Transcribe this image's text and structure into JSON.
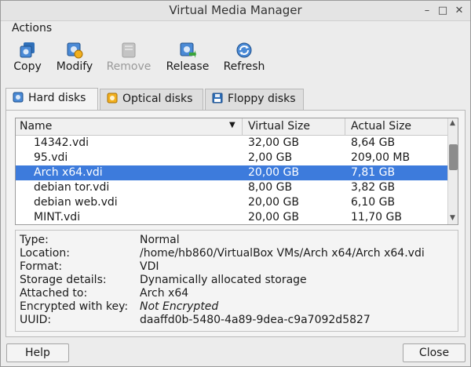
{
  "window": {
    "title": "Virtual Media Manager"
  },
  "menubar": {
    "actions_label": "Actions"
  },
  "toolbar": {
    "copy": {
      "label": "Copy",
      "icon": "copy-disk-icon"
    },
    "modify": {
      "label": "Modify",
      "icon": "modify-disk-icon"
    },
    "remove": {
      "label": "Remove",
      "icon": "remove-disk-icon",
      "enabled": false
    },
    "release": {
      "label": "Release",
      "icon": "release-disk-icon"
    },
    "refresh": {
      "label": "Refresh",
      "icon": "refresh-icon"
    }
  },
  "tabs": [
    {
      "label": "Hard disks",
      "active": true
    },
    {
      "label": "Optical disks",
      "active": false
    },
    {
      "label": "Floppy disks",
      "active": false
    }
  ],
  "list": {
    "columns": [
      "Name",
      "Virtual Size",
      "Actual Size"
    ],
    "rows": [
      {
        "name": "14342.vdi",
        "virtual": "32,00 GB",
        "actual": "8,64 GB"
      },
      {
        "name": "95.vdi",
        "virtual": "2,00 GB",
        "actual": "209,00 MB"
      },
      {
        "name": "Arch x64.vdi",
        "virtual": "20,00 GB",
        "actual": "7,81 GB",
        "selected": true
      },
      {
        "name": "debian tor.vdi",
        "virtual": "8,00 GB",
        "actual": "3,82 GB"
      },
      {
        "name": "debian web.vdi",
        "virtual": "20,00 GB",
        "actual": "6,10 GB"
      },
      {
        "name": "MINT.vdi",
        "virtual": "20,00 GB",
        "actual": "11,70 GB"
      }
    ]
  },
  "details": [
    {
      "key": "Type:",
      "value": "Normal"
    },
    {
      "key": "Location:",
      "value": "/home/hb860/VirtualBox VMs/Arch x64/Arch x64.vdi"
    },
    {
      "key": "Format:",
      "value": "VDI"
    },
    {
      "key": "Storage details:",
      "value": "Dynamically allocated storage"
    },
    {
      "key": "Attached to:",
      "value": "Arch x64"
    },
    {
      "key": "Encrypted with key:",
      "value": "Not Encrypted"
    },
    {
      "key": "UUID:",
      "value": "daaffd0b-5480-4a89-9dea-c9a7092d5827"
    }
  ],
  "buttons": {
    "help": "Help",
    "close": "Close"
  },
  "colors": {
    "selection": "#3d7bdc",
    "icon_blue": "#2f6fb8",
    "icon_accent": "#f2b01e"
  }
}
